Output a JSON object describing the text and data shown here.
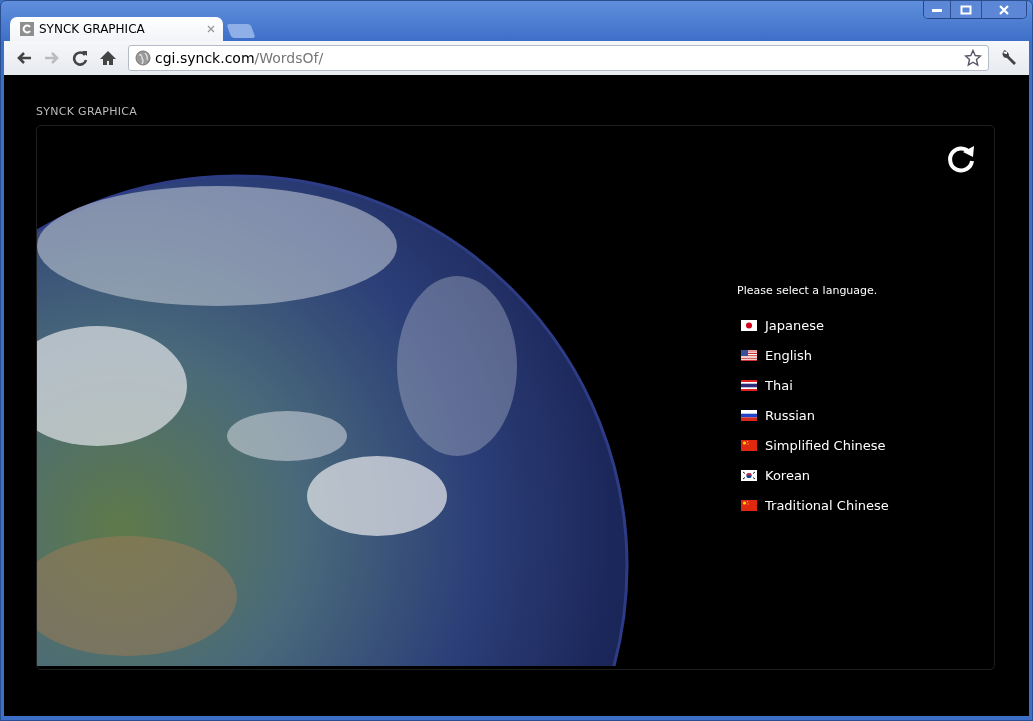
{
  "tab": {
    "title": "SYNCK GRAPHICA",
    "selected": true
  },
  "address_bar": {
    "host": "cgi.synck.com",
    "path": "/WordsOf/"
  },
  "page": {
    "site_title": "SYNCK GRAPHICA",
    "prompt": "Please select a language.",
    "languages": [
      {
        "label": "Japanese",
        "kind": "jp"
      },
      {
        "label": "English",
        "kind": "us"
      },
      {
        "label": "Thai",
        "kind": "th"
      },
      {
        "label": "Russian",
        "kind": "ru"
      },
      {
        "label": "Simplified Chinese",
        "kind": "cn"
      },
      {
        "label": "Korean",
        "kind": "kr"
      },
      {
        "label": "Traditional Chinese",
        "kind": "cn"
      }
    ]
  }
}
